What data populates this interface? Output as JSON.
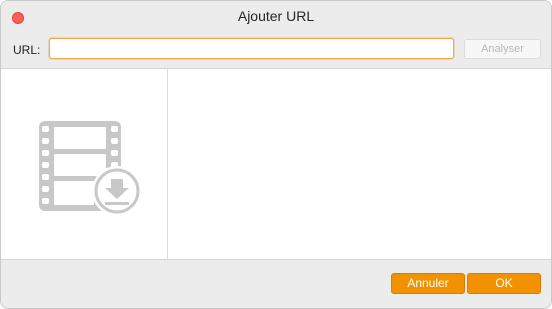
{
  "window": {
    "title": "Ajouter URL"
  },
  "url_bar": {
    "label": "URL:",
    "value": "",
    "placeholder": "",
    "analyze_label": "Analyser"
  },
  "preview": {
    "icon": "film-download-icon"
  },
  "footer": {
    "cancel_label": "Annuler",
    "ok_label": "OK"
  },
  "colors": {
    "accent": "#f39200",
    "focus_ring": "#f5a64a",
    "close": "#ff5f57"
  }
}
